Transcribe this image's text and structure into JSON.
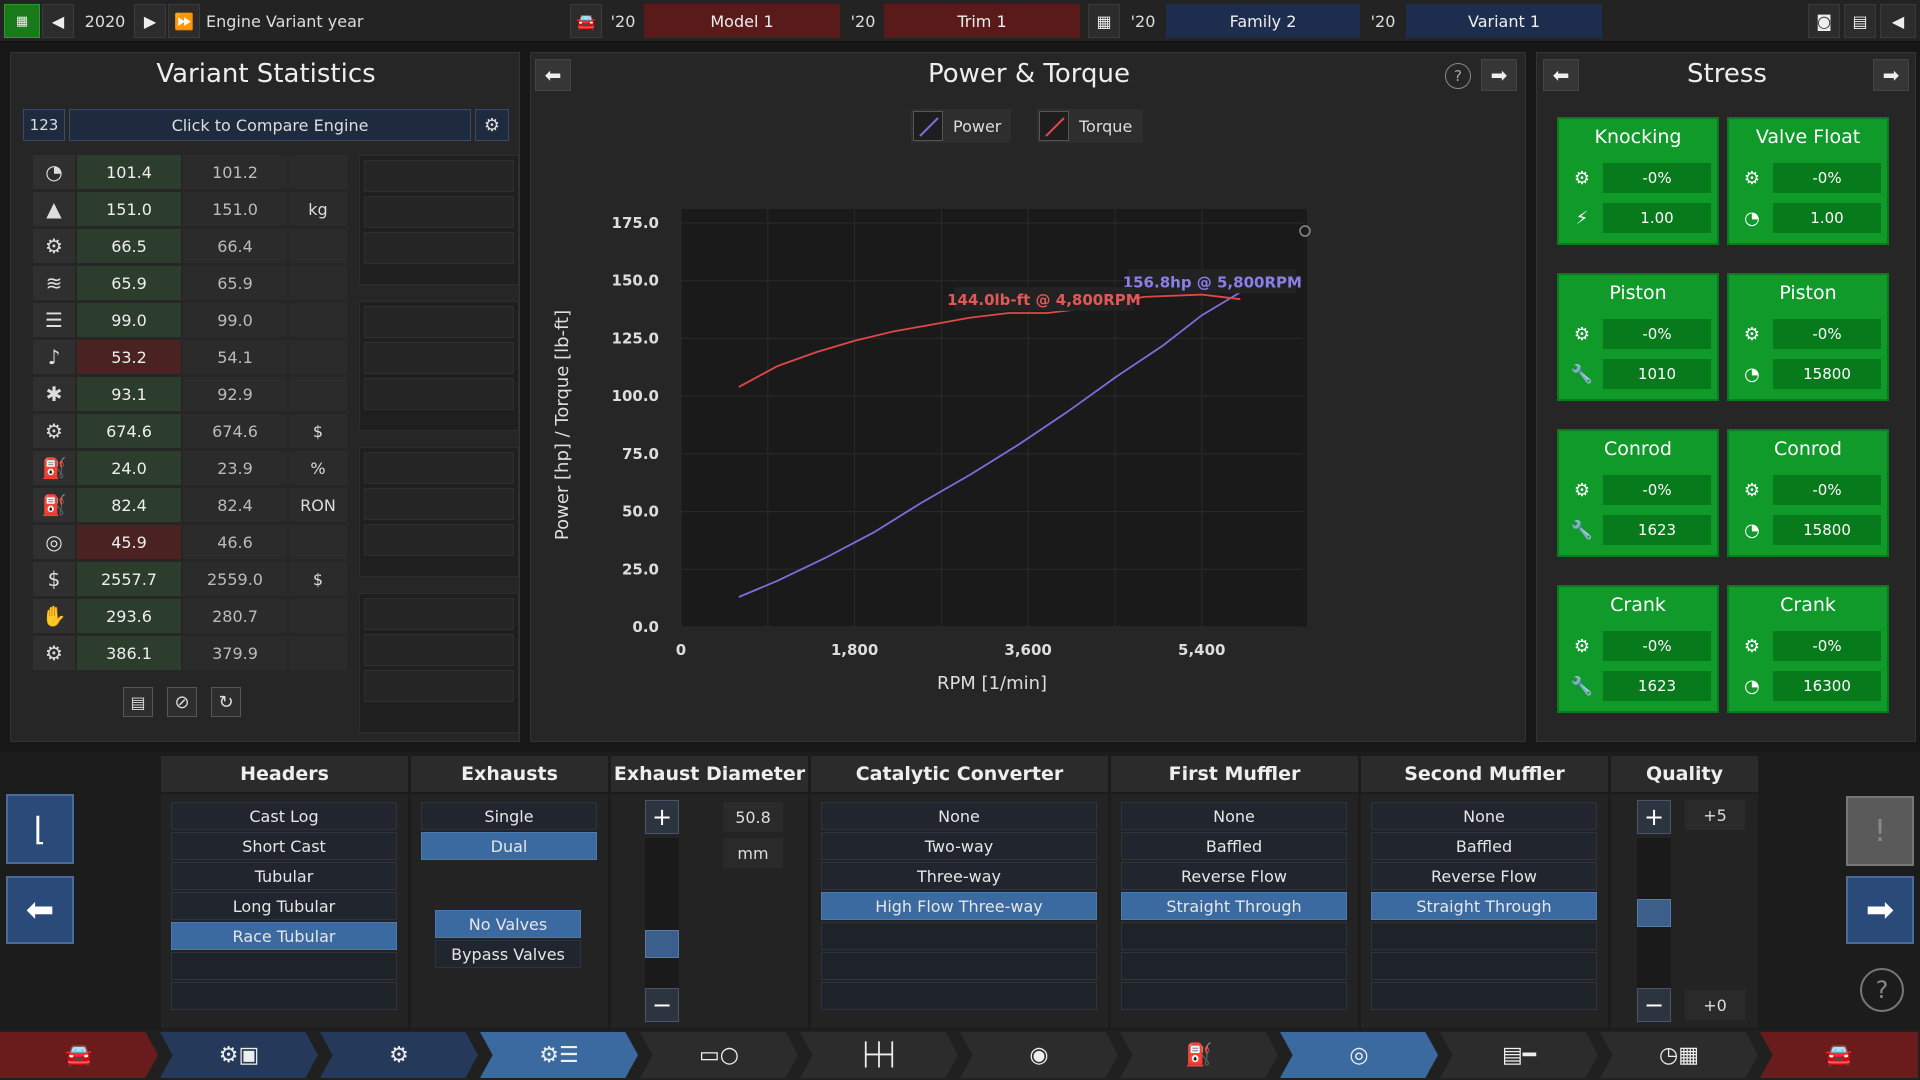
{
  "topbar": {
    "year": "2020",
    "label": "Engine Variant year",
    "model_year": "'20",
    "model": "Model 1",
    "trim_year": "'20",
    "trim": "Trim 1",
    "family_year": "'20",
    "family": "Family 2",
    "variant_year": "'20",
    "variant": "Variant 1"
  },
  "stats": {
    "title": "Variant Statistics",
    "num_badge": "123",
    "compare": "Click to Compare Engine",
    "rows": [
      {
        "icon": "rpm-gauge-icon",
        "glyph": "◔",
        "v1": "101.4",
        "v2": "101.2",
        "unit": "",
        "hl": false
      },
      {
        "icon": "weight-icon",
        "glyph": "▲",
        "v1": "151.0",
        "v2": "151.0",
        "unit": "kg",
        "hl": false
      },
      {
        "icon": "engine-icon",
        "glyph": "⚙",
        "v1": "66.5",
        "v2": "66.4",
        "unit": "",
        "hl": false
      },
      {
        "icon": "smoothness-icon",
        "glyph": "≋",
        "v1": "65.9",
        "v2": "65.9",
        "unit": "",
        "hl": false
      },
      {
        "icon": "radiator-icon",
        "glyph": "☰",
        "v1": "99.0",
        "v2": "99.0",
        "unit": "",
        "hl": false
      },
      {
        "icon": "sound-icon",
        "glyph": "♪",
        "v1": "53.2",
        "v2": "54.1",
        "unit": "",
        "hl": true
      },
      {
        "icon": "emissions-icon",
        "glyph": "✱",
        "v1": "93.1",
        "v2": "92.9",
        "unit": "",
        "hl": false
      },
      {
        "icon": "engineering-cost-icon",
        "glyph": "⚙",
        "v1": "674.6",
        "v2": "674.6",
        "unit": "$",
        "hl": false
      },
      {
        "icon": "efficiency-icon",
        "glyph": "⛽",
        "v1": "24.0",
        "v2": "23.9",
        "unit": "%",
        "hl": false
      },
      {
        "icon": "fuel-pump-icon",
        "glyph": "⛽",
        "v1": "82.4",
        "v2": "82.4",
        "unit": "RON",
        "hl": false
      },
      {
        "icon": "reliability-icon",
        "glyph": "◎",
        "v1": "45.9",
        "v2": "46.6",
        "unit": "",
        "hl": true
      },
      {
        "icon": "material-cost-icon",
        "glyph": "$",
        "v1": "2557.7",
        "v2": "2559.0",
        "unit": "$",
        "hl": false
      },
      {
        "icon": "service-cost-icon",
        "glyph": "✋",
        "v1": "293.6",
        "v2": "280.7",
        "unit": "",
        "hl": false
      },
      {
        "icon": "production-units-icon",
        "glyph": "⚙",
        "v1": "386.1",
        "v2": "379.9",
        "unit": "",
        "hl": false
      }
    ]
  },
  "chart": {
    "title": "Power & Torque",
    "legend_power": "Power",
    "legend_torque": "Torque",
    "power_label": "156.8hp @ 5,800RPM",
    "torque_label": "144.0lb-ft @ 4,800RPM",
    "colors": {
      "power": "#7b6fe0",
      "torque": "#e04848"
    }
  },
  "chart_data": {
    "type": "line",
    "title": "Power & Torque",
    "xlabel": "RPM [1/min]",
    "ylabel": "Power [hp] / Torque [lb-ft]",
    "xlim": [
      0,
      6450
    ],
    "ylim": [
      0,
      175
    ],
    "xticks": [
      "0",
      "1,800",
      "3,600",
      "5,400"
    ],
    "yticks": [
      "0.0",
      "25.0",
      "50.0",
      "75.0",
      "100.0",
      "125.0",
      "150.0",
      "175.0"
    ],
    "series": [
      {
        "name": "Power",
        "x": [
          600,
          1000,
          1500,
          2000,
          2500,
          3000,
          3500,
          4000,
          4500,
          5000,
          5400,
          5800
        ],
        "y": [
          13,
          20,
          30,
          41,
          54,
          66,
          79,
          93,
          108,
          122,
          135,
          145
        ]
      },
      {
        "name": "Torque",
        "x": [
          600,
          1000,
          1400,
          1800,
          2200,
          2600,
          3000,
          3400,
          3800,
          4200,
          4800,
          5400,
          5800
        ],
        "y": [
          104,
          113,
          119,
          124,
          128,
          131,
          134,
          136,
          136,
          138,
          143,
          144,
          142
        ]
      }
    ]
  },
  "stress": {
    "title": "Stress",
    "cards": [
      {
        "title": "Knocking",
        "r1": "-0%",
        "r2": "1.00",
        "i2": "spark-icon",
        "g2": "⚡"
      },
      {
        "title": "Valve Float",
        "r1": "-0%",
        "r2": "1.00",
        "i2": "rpm-gauge-icon",
        "g2": "◔"
      },
      {
        "title": "Piston",
        "r1": "-0%",
        "r2": "1010",
        "i2": "wrench-icon",
        "g2": "🔧"
      },
      {
        "title": "Piston",
        "r1": "-0%",
        "r2": "15800",
        "i2": "rpm-gauge-icon",
        "g2": "◔"
      },
      {
        "title": "Conrod",
        "r1": "-0%",
        "r2": "1623",
        "i2": "wrench-icon",
        "g2": "🔧"
      },
      {
        "title": "Conrod",
        "r1": "-0%",
        "r2": "15800",
        "i2": "rpm-gauge-icon",
        "g2": "◔"
      },
      {
        "title": "Crank",
        "r1": "-0%",
        "r2": "1623",
        "i2": "wrench-icon",
        "g2": "🔧"
      },
      {
        "title": "Crank",
        "r1": "-0%",
        "r2": "16300",
        "i2": "rpm-gauge-icon",
        "g2": "◔"
      }
    ]
  },
  "exhaust": {
    "headers_title": "Headers",
    "headers": [
      "Cast Log",
      "Short Cast",
      "Tubular",
      "Long Tubular",
      "Race Tubular"
    ],
    "headers_sel": 4,
    "exhausts_title": "Exhausts",
    "exhausts": [
      "Single",
      "Dual"
    ],
    "exhausts_sel": 1,
    "valves": [
      "No Valves",
      "Bypass Valves"
    ],
    "valves_sel": 0,
    "diameter_title": "Exhaust Diameter",
    "diameter_value": "50.8",
    "diameter_unit": "mm",
    "diameter_level": 0.25,
    "cat_title": "Catalytic Converter",
    "cats": [
      "None",
      "Two-way",
      "Three-way",
      "High Flow Three-way"
    ],
    "cat_sel": 3,
    "muffler1_title": "First Muffler",
    "muffler1": [
      "None",
      "Baffled",
      "Reverse Flow",
      "Straight Through"
    ],
    "muffler1_sel": 3,
    "muffler2_title": "Second Muffler",
    "muffler2": [
      "None",
      "Baffled",
      "Reverse Flow",
      "Straight Through"
    ],
    "muffler2_sel": 3,
    "quality_title": "Quality",
    "quality_max": "+5",
    "quality_min": "+0",
    "quality_level": 0.5
  },
  "bottom_nav": [
    {
      "name": "nav-car-icon",
      "glyph": "🚘"
    },
    {
      "name": "nav-engine-family-icon",
      "glyph": "⚙▣"
    },
    {
      "name": "nav-engine-icon",
      "glyph": "⚙"
    },
    {
      "name": "nav-engine-variant-icon",
      "glyph": "⚙☰"
    },
    {
      "name": "nav-tools-icon",
      "glyph": "▭○"
    },
    {
      "name": "nav-bottom-end-icon",
      "glyph": "├┼┤"
    },
    {
      "name": "nav-turbo-icon",
      "glyph": "◉"
    },
    {
      "name": "nav-fuel-icon",
      "glyph": "⛽"
    },
    {
      "name": "nav-exhaust-icon",
      "glyph": "◎"
    },
    {
      "name": "nav-exhaust-pipe-icon",
      "glyph": "▤━"
    },
    {
      "name": "nav-test-icon",
      "glyph": "◷▦"
    },
    {
      "name": "nav-car-design-icon",
      "glyph": "🚘"
    }
  ]
}
